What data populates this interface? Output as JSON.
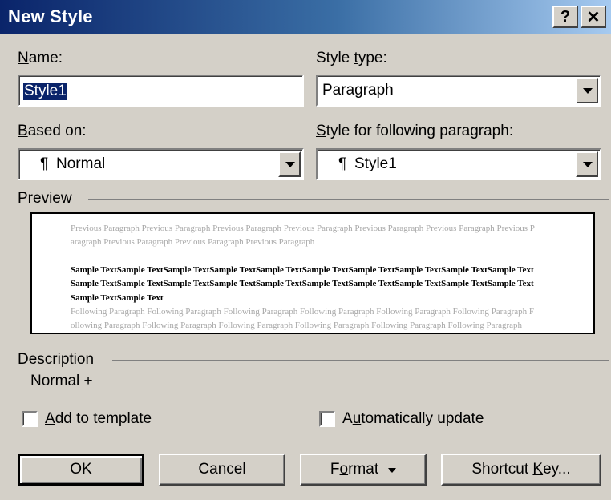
{
  "window": {
    "title": "New Style",
    "help_label": "?",
    "close_label": "✕"
  },
  "name": {
    "label_u": "N",
    "label_rest": "ame:",
    "value": "Style1"
  },
  "style_type": {
    "label_pre": "Style ",
    "label_u": "t",
    "label_rest": "ype:",
    "value": "Paragraph"
  },
  "based_on": {
    "label_u": "B",
    "label_rest": "ased on:",
    "mark": "¶",
    "value": "Normal"
  },
  "following": {
    "label_u": "S",
    "label_rest": "tyle for following paragraph:",
    "mark": "¶",
    "value": "Style1"
  },
  "preview": {
    "label": "Preview",
    "previous_text": "Previous Paragraph Previous Paragraph Previous Paragraph Previous Paragraph Previous Paragraph Previous Paragraph Previous Paragraph Previous Paragraph Previous Paragraph Previous Paragraph",
    "sample_text": "Sample TextSample TextSample TextSample TextSample TextSample TextSample TextSample TextSample TextSample TextSample TextSample TextSample TextSample TextSample TextSample TextSample TextSample TextSample TextSample TextSample TextSample Text",
    "following_text": "Following Paragraph Following Paragraph Following Paragraph Following Paragraph Following Paragraph Following Paragraph Following Paragraph Following Paragraph Following Paragraph Following Paragraph Following Paragraph Following Paragraph"
  },
  "description": {
    "label": "Description",
    "value": "Normal +"
  },
  "add_to_template": {
    "label_u": "A",
    "label_rest": "dd to template",
    "checked": false
  },
  "auto_update": {
    "label_pre": "A",
    "label_u": "u",
    "label_rest": "tomatically update",
    "checked": false
  },
  "buttons": {
    "ok": "OK",
    "cancel": "Cancel",
    "format_pre": "F",
    "format_u": "o",
    "format_rest": "rmat",
    "shortcut_pre": "Shortcut ",
    "shortcut_u": "K",
    "shortcut_rest": "ey..."
  }
}
